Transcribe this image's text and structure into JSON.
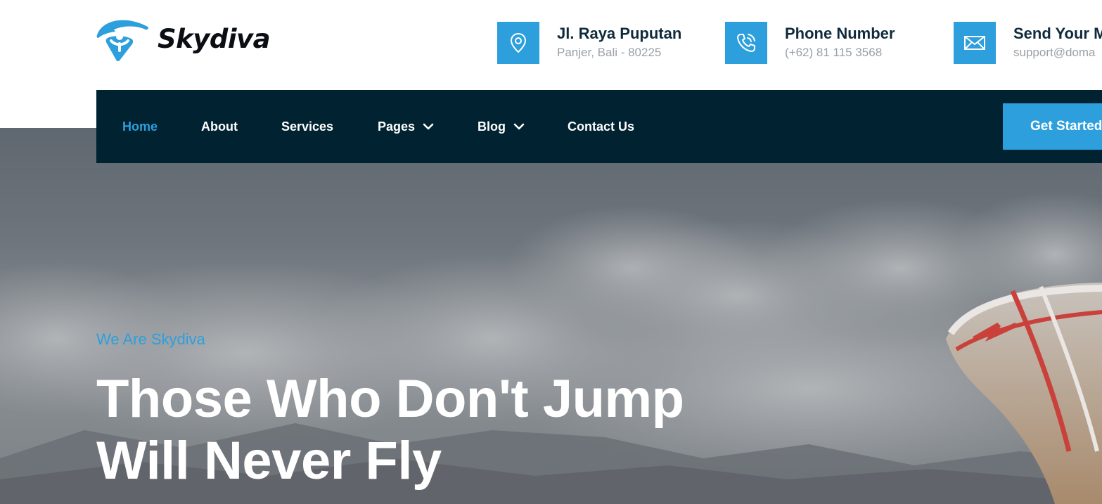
{
  "brand": {
    "name": "Skydiva",
    "logo_icon": "paraglider-person-icon",
    "accent_color": "#2d9fdc"
  },
  "contacts": [
    {
      "icon": "map-pin-icon",
      "title": "Jl. Raya Puputan",
      "subtitle": "Panjer, Bali - 80225"
    },
    {
      "icon": "phone-icon",
      "title": "Phone Number",
      "subtitle": "(+62) 81 115 3568"
    },
    {
      "icon": "envelope-icon",
      "title": "Send Your M",
      "subtitle": "support@doma"
    }
  ],
  "nav": {
    "background_color": "#002231",
    "items": [
      {
        "label": "Home",
        "active": true
      },
      {
        "label": "About"
      },
      {
        "label": "Services"
      },
      {
        "label": "Pages",
        "dropdown": true
      },
      {
        "label": "Blog",
        "dropdown": true
      },
      {
        "label": "Contact Us"
      }
    ],
    "cta_label": "Get Started"
  },
  "hero": {
    "eyebrow": "We Are Skydiva",
    "title_line1": "Those Who Don't Jump",
    "title_line2": "Will Never Fly"
  }
}
